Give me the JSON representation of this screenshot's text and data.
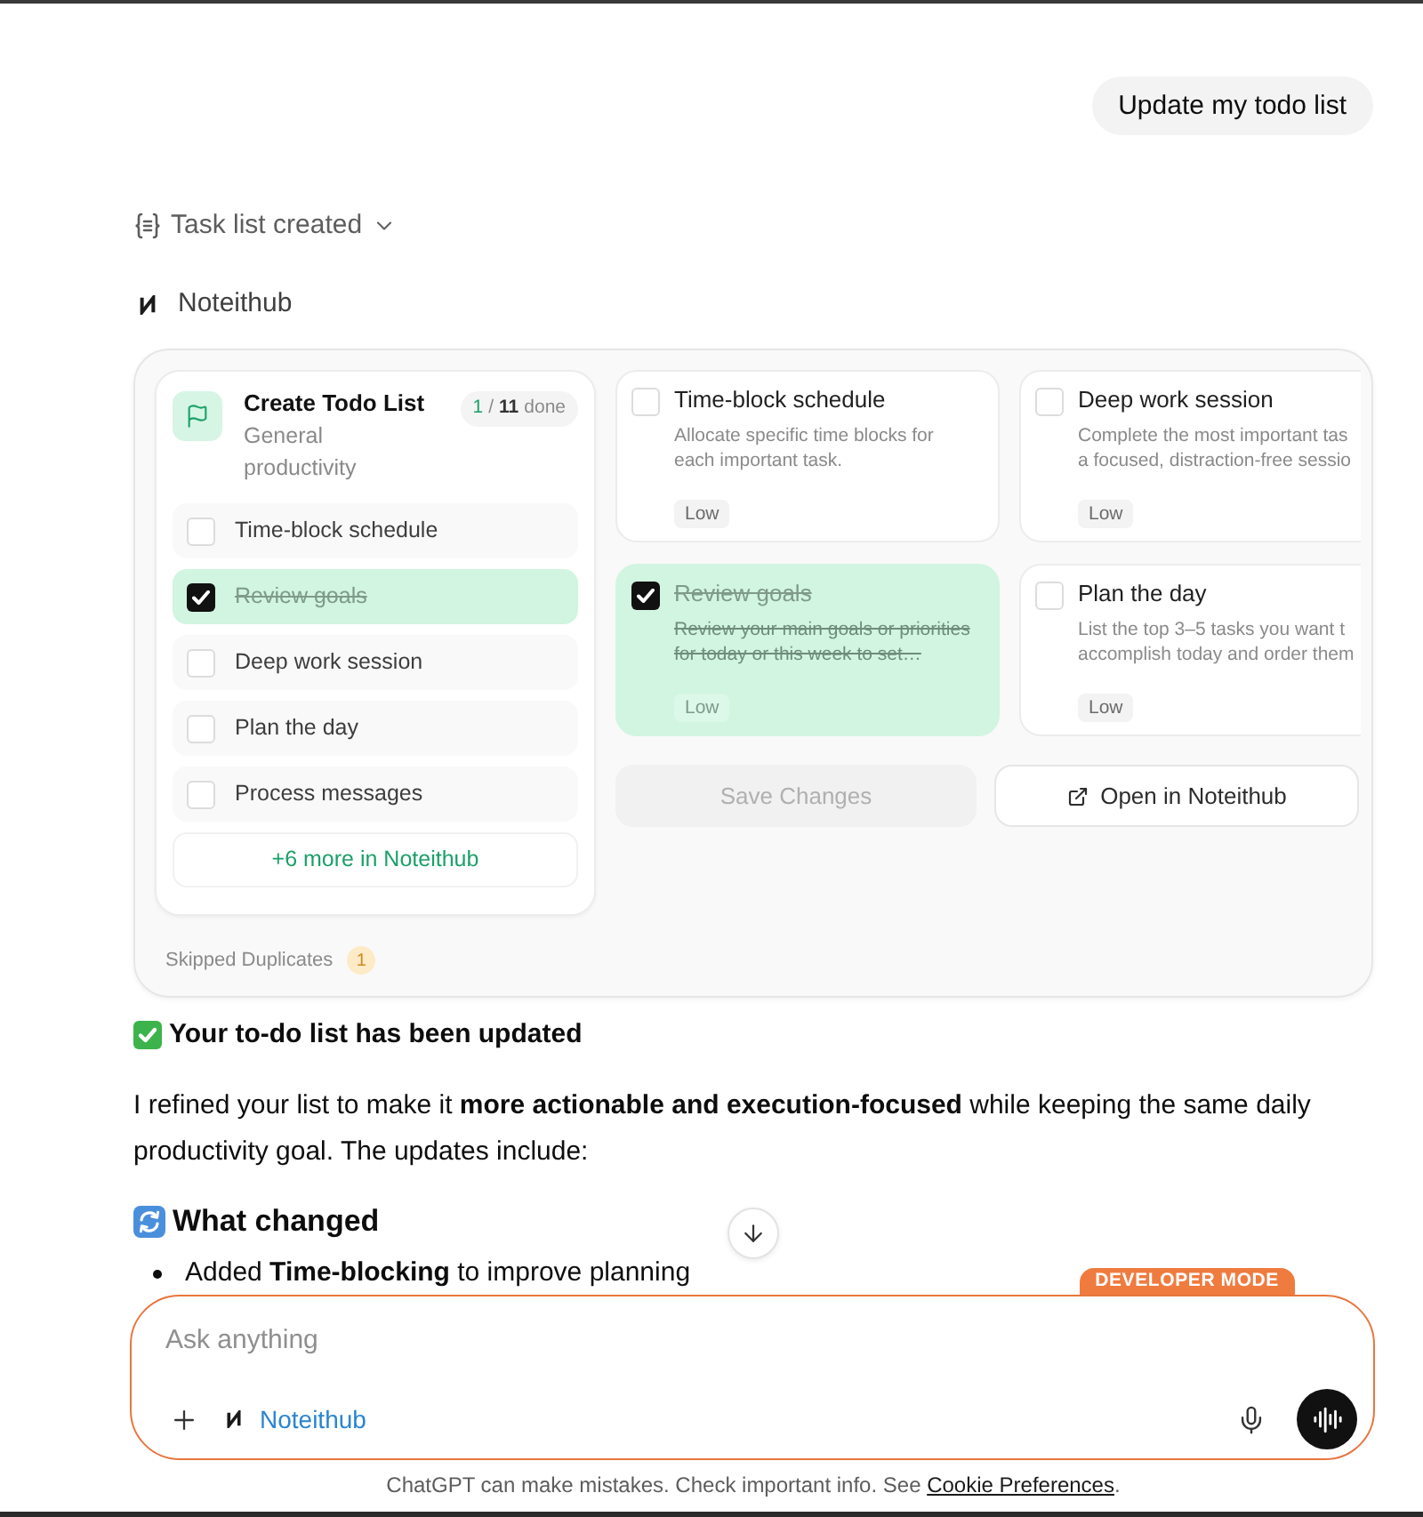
{
  "user_message": {
    "text": "Update my todo list"
  },
  "tool_status": {
    "label": "Task list created"
  },
  "app_label": {
    "name": "Noteithub"
  },
  "widget": {
    "list": {
      "title": "Create Todo List",
      "subtitle": "General productivity",
      "progress": {
        "done": "1",
        "separator": "/",
        "total": "11",
        "label": "done"
      },
      "items": [
        {
          "label": "Time-block schedule",
          "checked": false
        },
        {
          "label": "Review goals",
          "checked": true
        },
        {
          "label": "Deep work session",
          "checked": false
        },
        {
          "label": "Plan the day",
          "checked": false
        },
        {
          "label": "Process messages",
          "checked": false
        }
      ],
      "more_link": "+6 more in Noteithub"
    },
    "cards": [
      {
        "title": "Time-block schedule",
        "description": [
          "Allocate specific time blocks for",
          "each important task."
        ],
        "priority": "Low",
        "checked": false
      },
      {
        "title": "Deep work session",
        "description": [
          "Complete the most important tas",
          "a focused, distraction-free sessio"
        ],
        "priority": "Low",
        "checked": false
      },
      {
        "title": "Review goals",
        "description": [
          "Review your main goals or priorities",
          "for today or this week to set…"
        ],
        "priority": "Low",
        "checked": true
      },
      {
        "title": "Plan the day",
        "description": [
          "List the top 3–5 tasks you want t",
          "accomplish today and order them"
        ],
        "priority": "Low",
        "checked": false
      }
    ],
    "buttons": [
      {
        "label": "Save Changes",
        "kind": "save",
        "disabled": true
      },
      {
        "label": "Open in Noteithub",
        "kind": "open",
        "disabled": false
      }
    ],
    "skipped": {
      "label": "Skipped Duplicates",
      "count": "1"
    }
  },
  "response": {
    "heading": "Your to-do list has been updated",
    "paragraph": "I refined your list to make it **more actionable and execution-focused** while keeping the same daily productivity goal. The updates include:",
    "section_title": "What changed",
    "bullets": [
      "Added **Time-blocking** to improve planning"
    ]
  },
  "composer": {
    "badge": "DEVELOPER MODE",
    "placeholder": "Ask anything",
    "app_chip": "Noteithub"
  },
  "footer": {
    "text": "ChatGPT can make mistakes. Check important info. See",
    "link": "Cookie Preferences",
    "end": "."
  }
}
